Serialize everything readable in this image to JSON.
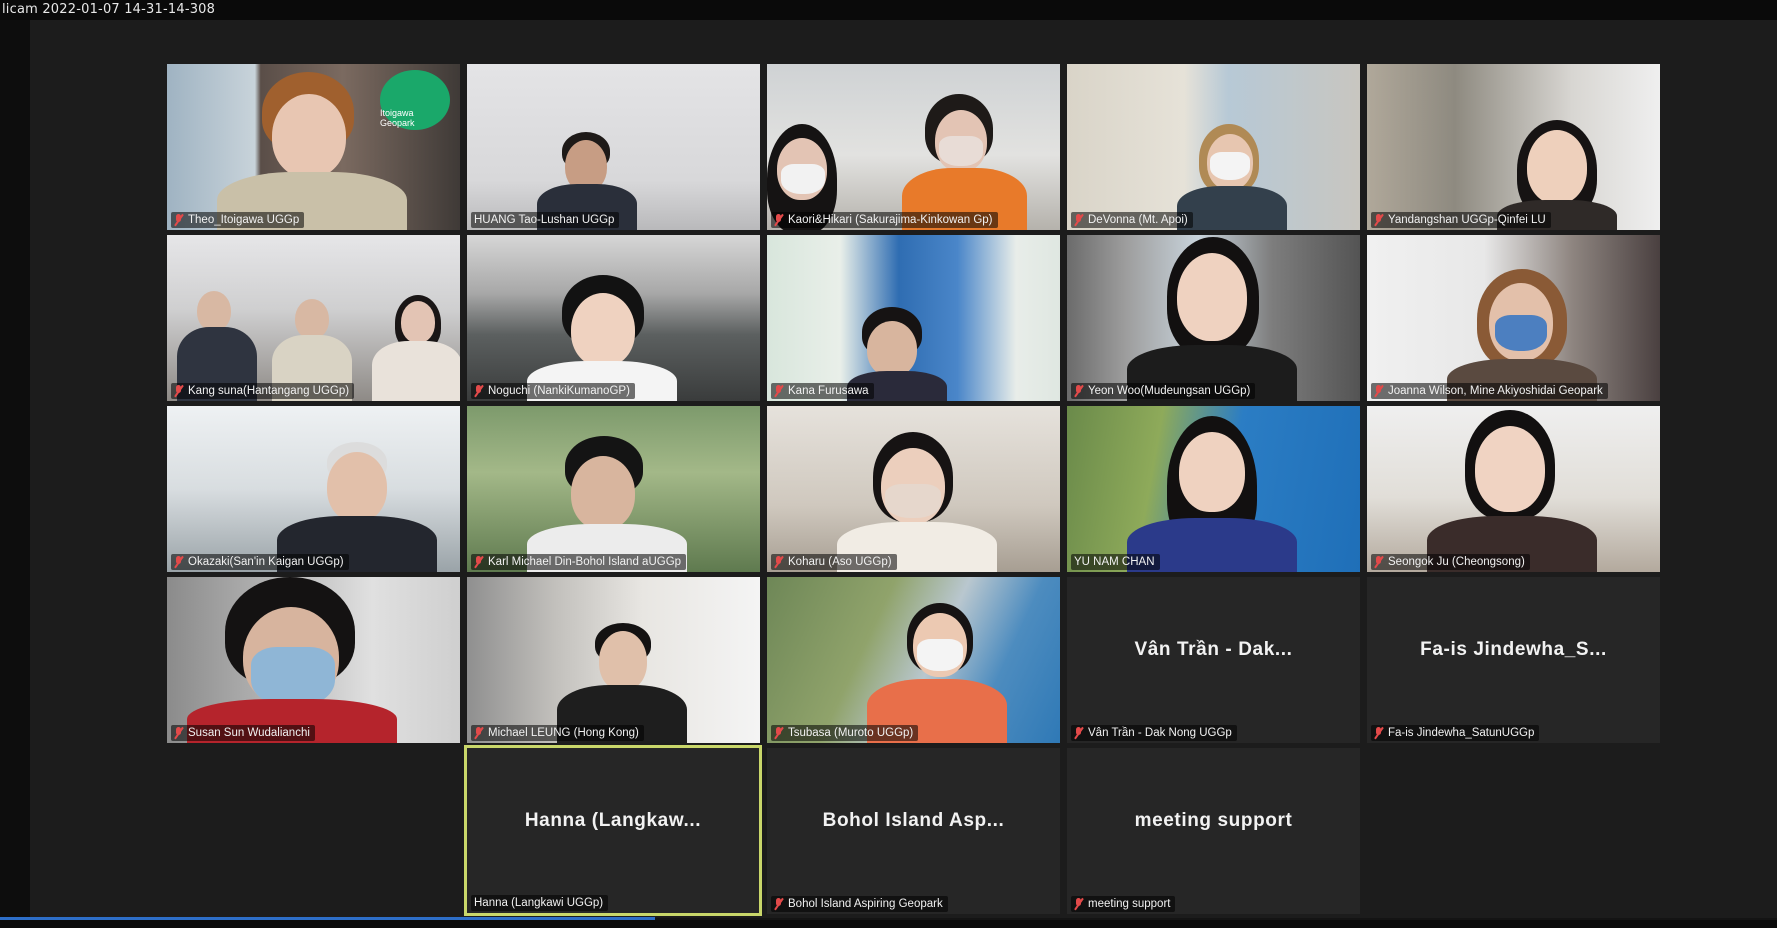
{
  "recorder_stamp": "licam 2022-01-07 14-31-14-308",
  "participants": [
    {
      "name": "Theo_Itoigawa UGGp",
      "muted": true
    },
    {
      "name": "HUANG Tao-Lushan UGGp",
      "muted": false
    },
    {
      "name": "Kaori&Hikari (Sakurajima-Kinkowan Gp)",
      "muted": true
    },
    {
      "name": "DeVonna (Mt. Apoi)",
      "muted": true
    },
    {
      "name": "Yandangshan UGGp-Qinfei LU",
      "muted": true
    },
    {
      "name": "Kang suna(Hantangang UGGp)",
      "muted": true
    },
    {
      "name": "Noguchi (NankiKumanoGP)",
      "muted": true
    },
    {
      "name": "Kana Furusawa",
      "muted": true
    },
    {
      "name": "Yeon Woo(Mudeungsan UGGp)",
      "muted": true
    },
    {
      "name": "Joanna Wilson, Mine Akiyoshidai Geopark",
      "muted": true
    },
    {
      "name": "Okazaki(San'in Kaigan UGGp)",
      "muted": true
    },
    {
      "name": "Karl Michael Din-Bohol Island aUGGp",
      "muted": true
    },
    {
      "name": "Koharu (Aso UGGp)",
      "muted": true
    },
    {
      "name": "YU NAM CHAN",
      "muted": false
    },
    {
      "name": "Seongok Ju (Cheongsong)",
      "muted": true
    },
    {
      "name": "Susan Sun Wudalianchi",
      "muted": true
    },
    {
      "name": "Michael LEUNG (Hong Kong)",
      "muted": true
    },
    {
      "name": "Tsubasa (Muroto UGGp)",
      "muted": true
    },
    {
      "name": "Vân Trần - Dak Nong UGGp",
      "display": "Vân Trần - Dak...",
      "muted": true
    },
    {
      "name": "Fa-is Jindewha_SatunUGGp",
      "display": "Fa-is Jindewha_S...",
      "muted": true
    },
    {
      "name": "Hanna (Langkawi UGGp)",
      "display": "Hanna (Langkaw...",
      "muted": false,
      "active_speaker": true
    },
    {
      "name": "Bohol Island Aspiring Geopark",
      "display": "Bohol Island Asp...",
      "muted": true
    },
    {
      "name": "meeting support",
      "display": "meeting support",
      "muted": true
    }
  ],
  "logo_text": "Itoigawa Geopark",
  "colors": {
    "active_border": "#c9d76a",
    "mute_icon": "#e34a4a",
    "progress": "#2d6ec8"
  }
}
